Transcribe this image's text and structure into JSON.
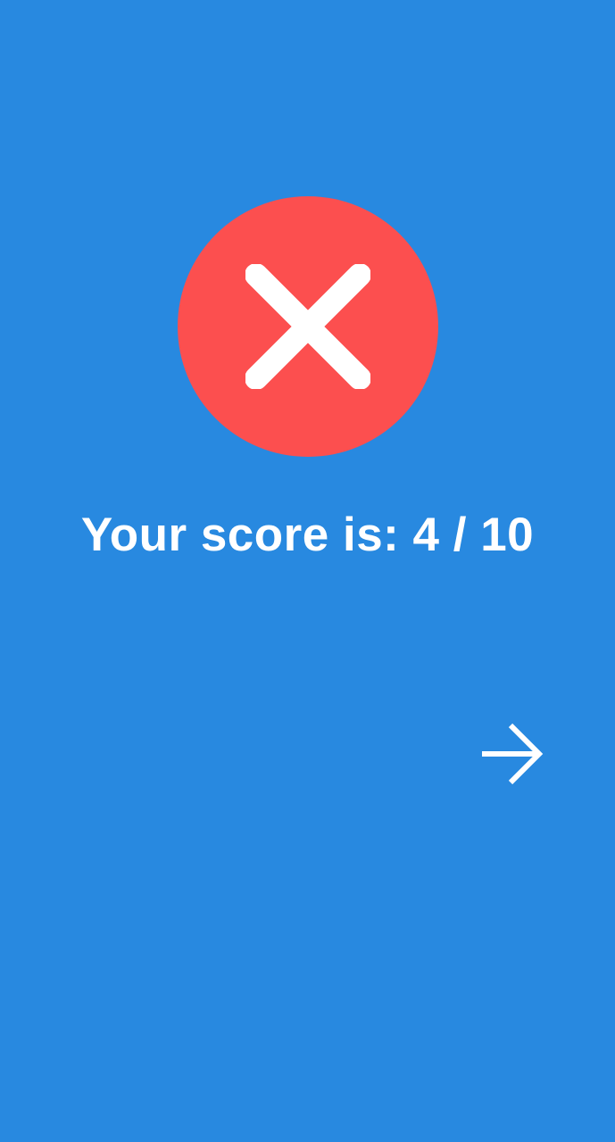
{
  "colors": {
    "background": "#2889e0",
    "result_circle": "#fc4f4f",
    "foreground": "#ffffff"
  },
  "result": {
    "icon": "close-icon",
    "state": "incorrect"
  },
  "score": {
    "text": "Your score is: 4 / 10"
  },
  "navigation": {
    "next_icon": "arrow-right-icon"
  }
}
